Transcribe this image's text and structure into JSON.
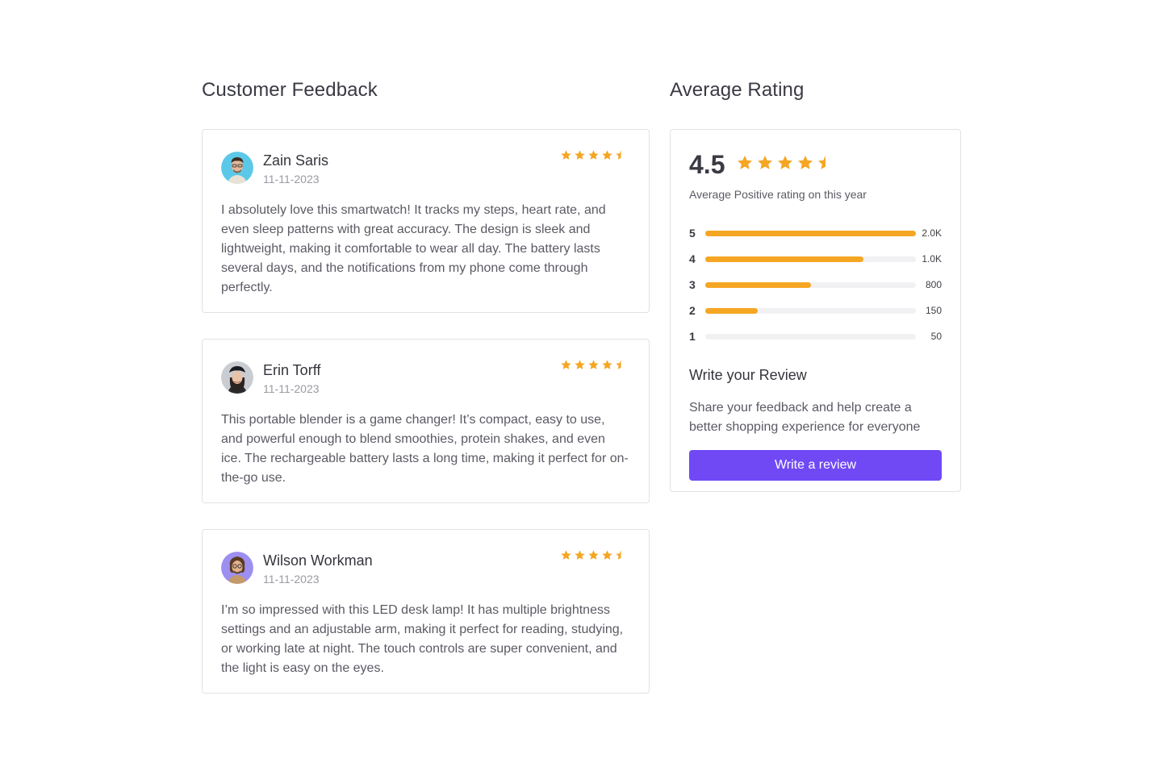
{
  "feedback": {
    "title": "Customer Feedback",
    "reviews": [
      {
        "name": "Zain Saris",
        "date": "11-11-2023",
        "rating": 4.5,
        "text": "I absolutely love this smartwatch! It tracks my steps, heart rate, and even sleep patterns with great accuracy. The design is sleek and lightweight, making it comfortable to wear all day. The battery lasts several days, and the notifications from my phone come through perfectly."
      },
      {
        "name": "Erin Torff",
        "date": "11-11-2023",
        "rating": 4.5,
        "text": "This portable blender is a game changer! It’s compact, easy to use, and powerful enough to blend smoothies, protein shakes, and even ice. The rechargeable battery lasts a long time, making it perfect for on-the-go use."
      },
      {
        "name": "Wilson Workman",
        "date": "11-11-2023",
        "rating": 4.5,
        "text": "I’m so impressed with this LED desk lamp! It has multiple brightness settings and an adjustable arm, making it perfect for reading, studying, or working late at night. The touch controls are super convenient, and the light is easy on the eyes."
      }
    ]
  },
  "rating": {
    "title": "Average Rating",
    "average": "4.5",
    "stars": 4.5,
    "caption": "Average Positive rating on this year",
    "breakdown": [
      {
        "label": "5",
        "count": "2.0K",
        "fraction": 1.0
      },
      {
        "label": "4",
        "count": "1.0K",
        "fraction": 0.75
      },
      {
        "label": "3",
        "count": "800",
        "fraction": 0.5
      },
      {
        "label": "2",
        "count": "150",
        "fraction": 0.25
      },
      {
        "label": "1",
        "count": "50",
        "fraction": 0.0
      }
    ],
    "write_title": "Write your Review",
    "write_text": "Share your feedback and help create a better shopping experience for everyone",
    "button_label": "Write a review"
  },
  "colors": {
    "star": "#f5a623",
    "accent": "#7049f5",
    "bar_track": "#f1f1f4"
  },
  "icons": {
    "star": "star-icon",
    "half_star": "half-star-icon"
  }
}
